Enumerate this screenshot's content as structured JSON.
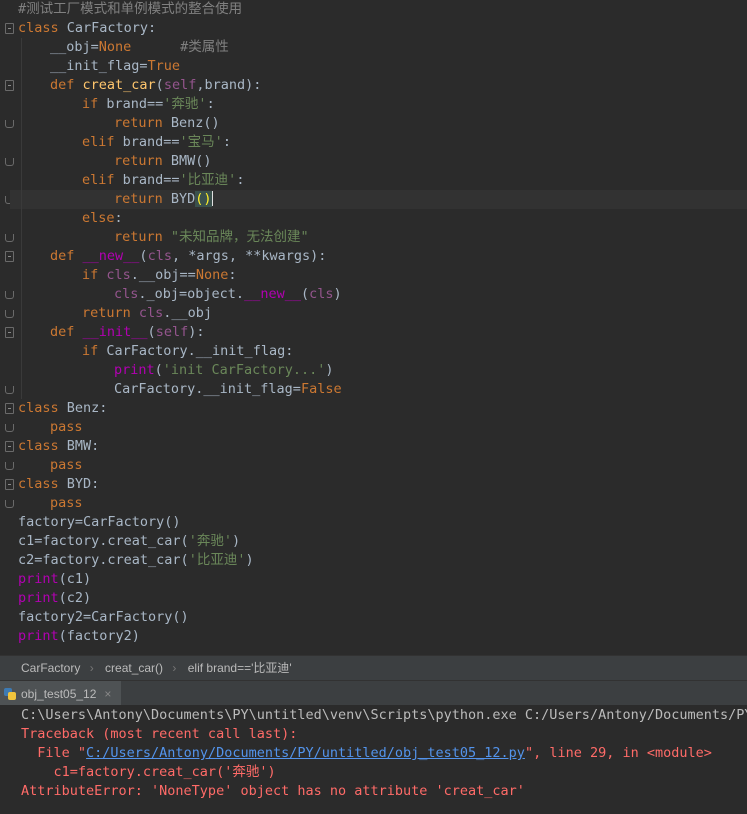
{
  "editor": {
    "lines": [
      {
        "indent": 0,
        "tokens": [
          {
            "t": "#测试工厂模式和单例模式的整合使用",
            "c": "comment"
          }
        ]
      },
      {
        "indent": 0,
        "tokens": [
          {
            "t": "class ",
            "c": "keyword"
          },
          {
            "t": "CarFactory:",
            "c": "default"
          }
        ]
      },
      {
        "indent": 1,
        "tokens": [
          {
            "t": "__obj=",
            "c": "default"
          },
          {
            "t": "None",
            "c": "keyword"
          },
          {
            "t": "      #类属性",
            "c": "comment"
          }
        ]
      },
      {
        "indent": 1,
        "tokens": [
          {
            "t": "__init_flag=",
            "c": "default"
          },
          {
            "t": "True",
            "c": "keyword"
          }
        ]
      },
      {
        "indent": 1,
        "tokens": [
          {
            "t": "def ",
            "c": "keyword"
          },
          {
            "t": "creat_car",
            "c": "func"
          },
          {
            "t": "(",
            "c": "default"
          },
          {
            "t": "self",
            "c": "self"
          },
          {
            "t": ",brand):",
            "c": "default"
          }
        ]
      },
      {
        "indent": 2,
        "tokens": [
          {
            "t": "if ",
            "c": "keyword"
          },
          {
            "t": "brand==",
            "c": "default"
          },
          {
            "t": "'奔驰'",
            "c": "string"
          },
          {
            "t": ":",
            "c": "default"
          }
        ]
      },
      {
        "indent": 3,
        "tokens": [
          {
            "t": "return ",
            "c": "keyword"
          },
          {
            "t": "Benz()",
            "c": "default"
          }
        ]
      },
      {
        "indent": 2,
        "tokens": [
          {
            "t": "elif ",
            "c": "keyword"
          },
          {
            "t": "brand==",
            "c": "default"
          },
          {
            "t": "'宝马'",
            "c": "string"
          },
          {
            "t": ":",
            "c": "default"
          }
        ]
      },
      {
        "indent": 3,
        "tokens": [
          {
            "t": "return ",
            "c": "keyword"
          },
          {
            "t": "BMW()",
            "c": "default"
          }
        ]
      },
      {
        "indent": 2,
        "tokens": [
          {
            "t": "elif ",
            "c": "keyword"
          },
          {
            "t": "brand==",
            "c": "default"
          },
          {
            "t": "'比亚迪'",
            "c": "string"
          },
          {
            "t": ":",
            "c": "default"
          }
        ]
      },
      {
        "indent": 3,
        "tokens": [
          {
            "t": "return ",
            "c": "keyword"
          },
          {
            "t": "BYD",
            "c": "default"
          },
          {
            "t": "()",
            "c": "caret-paren"
          }
        ],
        "caret": true
      },
      {
        "indent": 2,
        "tokens": [
          {
            "t": "else",
            "c": "keyword"
          },
          {
            "t": ":",
            "c": "default"
          }
        ]
      },
      {
        "indent": 3,
        "tokens": [
          {
            "t": "return ",
            "c": "keyword"
          },
          {
            "t": "\"未知品牌，无法创建\"",
            "c": "string"
          }
        ]
      },
      {
        "indent": 1,
        "tokens": [
          {
            "t": "def ",
            "c": "keyword"
          },
          {
            "t": "__new__",
            "c": "dunder"
          },
          {
            "t": "(",
            "c": "default"
          },
          {
            "t": "cls",
            "c": "self"
          },
          {
            "t": ", *args, **kwargs):",
            "c": "default"
          }
        ]
      },
      {
        "indent": 2,
        "tokens": [
          {
            "t": "if ",
            "c": "keyword"
          },
          {
            "t": "cls",
            "c": "self"
          },
          {
            "t": ".__obj==",
            "c": "default"
          },
          {
            "t": "None",
            "c": "keyword"
          },
          {
            "t": ":",
            "c": "default"
          }
        ]
      },
      {
        "indent": 3,
        "tokens": [
          {
            "t": "cls",
            "c": "self"
          },
          {
            "t": "._obj=object.",
            "c": "default"
          },
          {
            "t": "__new__",
            "c": "dunder"
          },
          {
            "t": "(",
            "c": "default"
          },
          {
            "t": "cls",
            "c": "self"
          },
          {
            "t": ")",
            "c": "default"
          }
        ]
      },
      {
        "indent": 2,
        "tokens": [
          {
            "t": "return ",
            "c": "keyword"
          },
          {
            "t": "cls",
            "c": "self"
          },
          {
            "t": ".__obj",
            "c": "default"
          }
        ]
      },
      {
        "indent": 1,
        "tokens": [
          {
            "t": "def ",
            "c": "keyword"
          },
          {
            "t": "__init__",
            "c": "dunder"
          },
          {
            "t": "(",
            "c": "default"
          },
          {
            "t": "self",
            "c": "self"
          },
          {
            "t": "):",
            "c": "default"
          }
        ]
      },
      {
        "indent": 2,
        "tokens": [
          {
            "t": "if ",
            "c": "keyword"
          },
          {
            "t": "CarFactory.__init_flag:",
            "c": "default"
          }
        ]
      },
      {
        "indent": 3,
        "tokens": [
          {
            "t": "print",
            "c": "dunder"
          },
          {
            "t": "(",
            "c": "default"
          },
          {
            "t": "'init CarFactory...'",
            "c": "string"
          },
          {
            "t": ")",
            "c": "default"
          }
        ]
      },
      {
        "indent": 3,
        "tokens": [
          {
            "t": "CarFactory.__init_flag=",
            "c": "default"
          },
          {
            "t": "False",
            "c": "keyword"
          }
        ]
      },
      {
        "indent": 0,
        "tokens": [
          {
            "t": "class ",
            "c": "keyword"
          },
          {
            "t": "Benz:",
            "c": "default"
          }
        ]
      },
      {
        "indent": 1,
        "tokens": [
          {
            "t": "pass",
            "c": "keyword"
          }
        ]
      },
      {
        "indent": 0,
        "tokens": [
          {
            "t": "class ",
            "c": "keyword"
          },
          {
            "t": "BMW:",
            "c": "default"
          }
        ]
      },
      {
        "indent": 1,
        "tokens": [
          {
            "t": "pass",
            "c": "keyword"
          }
        ]
      },
      {
        "indent": 0,
        "tokens": [
          {
            "t": "class ",
            "c": "keyword"
          },
          {
            "t": "BYD:",
            "c": "default"
          }
        ]
      },
      {
        "indent": 1,
        "tokens": [
          {
            "t": "pass",
            "c": "keyword"
          }
        ]
      },
      {
        "indent": 0,
        "tokens": [
          {
            "t": "factory=CarFactory()",
            "c": "default"
          }
        ]
      },
      {
        "indent": 0,
        "tokens": [
          {
            "t": "c1=factory.creat_car(",
            "c": "default"
          },
          {
            "t": "'奔驰'",
            "c": "string"
          },
          {
            "t": ")",
            "c": "default"
          }
        ]
      },
      {
        "indent": 0,
        "tokens": [
          {
            "t": "c2=factory.creat_car(",
            "c": "default"
          },
          {
            "t": "'比亚迪'",
            "c": "string"
          },
          {
            "t": ")",
            "c": "default"
          }
        ]
      },
      {
        "indent": 0,
        "tokens": [
          {
            "t": "print",
            "c": "dunder"
          },
          {
            "t": "(c1)",
            "c": "default"
          }
        ]
      },
      {
        "indent": 0,
        "tokens": [
          {
            "t": "print",
            "c": "dunder"
          },
          {
            "t": "(c2)",
            "c": "default"
          }
        ]
      },
      {
        "indent": 0,
        "tokens": [
          {
            "t": "factory2=CarFactory()",
            "c": "default"
          }
        ]
      },
      {
        "indent": 0,
        "tokens": [
          {
            "t": "print",
            "c": "dunder"
          },
          {
            "t": "(factory2)",
            "c": "default"
          }
        ]
      }
    ]
  },
  "breadcrumb": {
    "items": [
      "CarFactory",
      "creat_car()",
      "elif brand=='比亚迪'"
    ],
    "separator": "›"
  },
  "run_tab": {
    "label": "obj_test05_12",
    "close": "×",
    "icon": "python-icon"
  },
  "console": {
    "command": "C:\\Users\\Antony\\Documents\\PY\\untitled\\venv\\Scripts\\python.exe C:/Users/Antony/Documents/PY/",
    "traceback_header": "Traceback (most recent call last):",
    "file_prefix": "  File \"",
    "file_path": "C:/Users/Antony/Documents/PY/untitled/obj_test05_12.py",
    "file_suffix": "\", line 29, in <module>",
    "code_line": "    c1=factory.creat_car('奔驰')",
    "error": "AttributeError: 'NoneType' object has no attribute 'creat_car'"
  },
  "colors": {
    "editor_bg": "#2b2b2b",
    "keyword": "#cc7832",
    "string": "#6a8759",
    "comment": "#808080",
    "error": "#ff6b68",
    "link": "#5394ec"
  }
}
